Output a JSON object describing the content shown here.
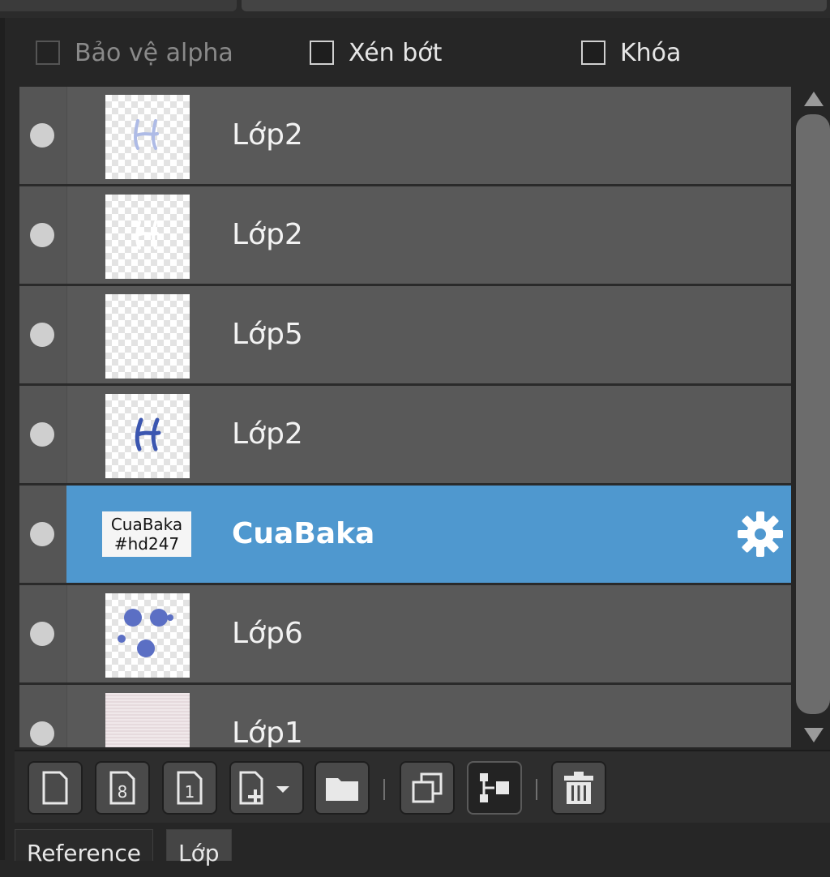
{
  "options": {
    "alpha_protect": {
      "label": "Bảo vệ alpha",
      "checked": false,
      "enabled": false
    },
    "clip": {
      "label": "Xén bớt",
      "checked": false
    },
    "lock": {
      "label": "Khóa",
      "checked": false
    }
  },
  "layers": [
    {
      "name": "Lớp2",
      "visible": true,
      "thumbnail": "script-h-faint-icon"
    },
    {
      "name": "Lớp2",
      "visible": true,
      "thumbnail": "script-h-white-icon"
    },
    {
      "name": "Lớp5",
      "visible": true,
      "thumbnail": "empty-transparent"
    },
    {
      "name": "Lớp2",
      "visible": true,
      "thumbnail": "script-h-blue-icon"
    },
    {
      "name": "CuaBaka",
      "visible": true,
      "selected": true,
      "thumbnail_line1": "CuaBaka",
      "thumbnail_line2": "#hd247",
      "settings_icon": "gear-icon"
    },
    {
      "name": "Lớp6",
      "visible": true,
      "thumbnail": "blue-dots-icon"
    },
    {
      "name": "Lớp1",
      "visible": true,
      "thumbnail": "pink-texture"
    }
  ],
  "toolbar": {
    "buttons": [
      "new-layer-icon",
      "new-8bit-layer-icon",
      "new-1bit-layer-icon",
      "add-layer-dropdown-icon",
      "new-folder-icon",
      "duplicate-layer-icon",
      "merge-layer-icon",
      "delete-layer-icon"
    ]
  },
  "tabs": [
    {
      "label": "Reference",
      "active": false
    },
    {
      "label": "Lớp",
      "active": true
    }
  ],
  "colors": {
    "selection": "#4f98cf",
    "row": "#595959",
    "panel": "#262626"
  }
}
